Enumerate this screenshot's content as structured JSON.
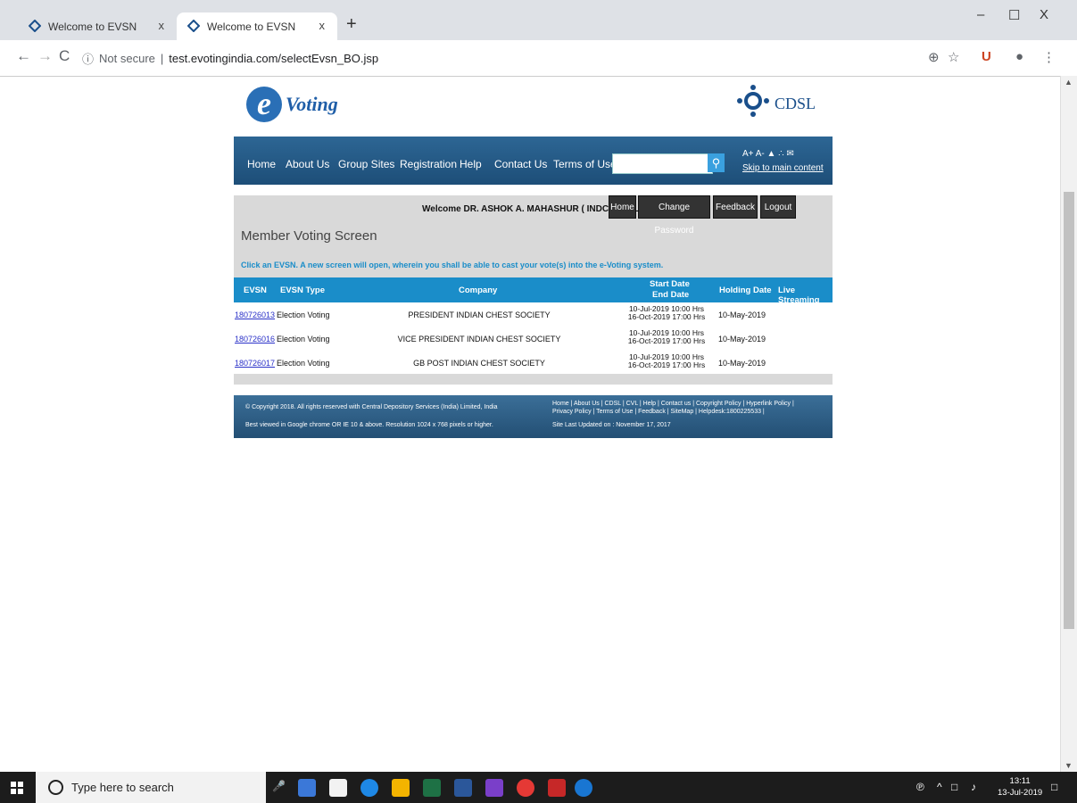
{
  "browser": {
    "tabs": [
      {
        "title": "Welcome to EVSN",
        "close": "x"
      },
      {
        "title": "Welcome to EVSN",
        "close": "x"
      }
    ],
    "new_tab": "+",
    "controls": {
      "minimize": "–",
      "maximize": "☐",
      "close": "X"
    },
    "security_label": "Not secure",
    "url": "test.evotingindia.com/selectEvsn_BO.jsp"
  },
  "header": {
    "logo_e": "e",
    "logo_text": "Voting",
    "cdsl_text": "CDSL"
  },
  "nav": {
    "items": [
      "Home",
      "About Us",
      "Group Sites",
      "Registration",
      "Help",
      "Contact Us",
      "Terms of Use"
    ],
    "search_value": "",
    "accessibility": "A+  A-",
    "skip_link": "Skip to main content"
  },
  "member": {
    "welcome": "Welcome DR. ASHOK A. MAHASHUR ( INDCHSCLL5 )",
    "buttons": [
      "Home",
      "Change Password",
      "Feedback",
      "Logout"
    ],
    "screen_title": "Member Voting Screen",
    "instruction": "Click an EVSN. A new screen will open, wherein you shall be able to cast your vote(s) into the e-Voting system."
  },
  "table": {
    "headers": {
      "evsn": "EVSN",
      "type": "EVSN Type",
      "company": "Company",
      "start": "Start Date",
      "end": "End Date",
      "holding": "Holding Date",
      "live": "Live Streaming"
    },
    "rows": [
      {
        "evsn": "180726013",
        "type": "Election Voting",
        "company": "PRESIDENT INDIAN CHEST SOCIETY",
        "start": "10-Jul-2019 10:00 Hrs",
        "end": "16-Oct-2019 17:00 Hrs",
        "holding": "10-May-2019"
      },
      {
        "evsn": "180726016",
        "type": "Election Voting",
        "company": "VICE PRESIDENT INDIAN CHEST SOCIETY",
        "start": "10-Jul-2019 10:00 Hrs",
        "end": "16-Oct-2019 17:00 Hrs",
        "holding": "10-May-2019"
      },
      {
        "evsn": "180726017",
        "type": "Election Voting",
        "company": "GB POST INDIAN CHEST SOCIETY",
        "start": "10-Jul-2019 10:00 Hrs",
        "end": "16-Oct-2019 17:00 Hrs",
        "holding": "10-May-2019"
      }
    ]
  },
  "footer": {
    "copyright": "© Copyright 2018. All rights reserved with Central Depository Services (India) Limited, India",
    "best_viewed": "Best viewed in Google chrome OR IE 10 & above. Resolution 1024 x 768 pixels or higher.",
    "links_line1": "Home | About Us | CDSL | CVL | Help | Contact us | Copyright Policy | Hyperlink Policy |",
    "links_line2": "Privacy Policy | Terms of Use | Feedback | SiteMap | Helpdesk:1800225533 |",
    "updated": "Site Last Updated on : November 17, 2017"
  },
  "taskbar": {
    "search_placeholder": "Type here to search",
    "time": "13:11",
    "date": "13-Jul-2019"
  },
  "colors": {
    "nav_blue": "#1d4e78",
    "table_header_blue": "#1a8dc9",
    "panel_gray": "#d9d9d9",
    "link_blue": "#2a31c8"
  }
}
